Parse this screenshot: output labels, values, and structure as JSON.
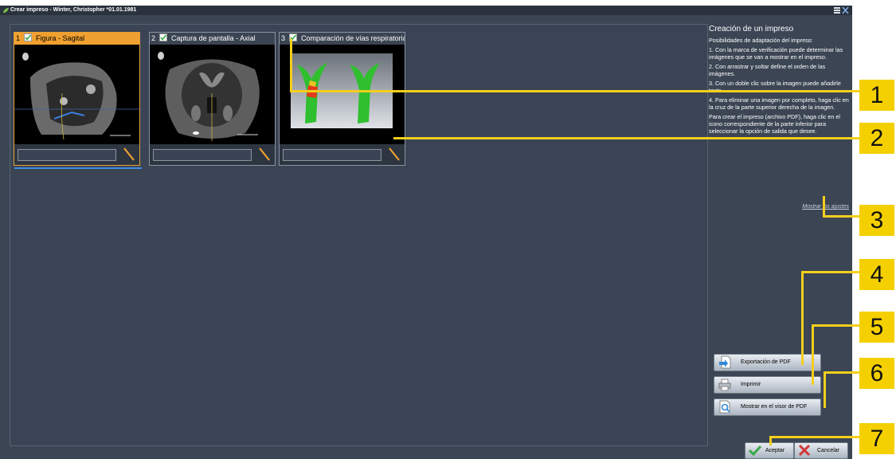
{
  "window": {
    "title": "Crear impreso - Winter, Christopher *01.01.1981"
  },
  "thumbnails": [
    {
      "number": "1",
      "label": "Figura - Sagital"
    },
    {
      "number": "2",
      "label": "Captura de pantalla - Axial"
    },
    {
      "number": "3",
      "label": "Comparación de vías respiratorias"
    }
  ],
  "panel": {
    "title": "Creación de un impreso",
    "subtitle": "Posibilidades de adaptación del impreso:",
    "step1": "1. Con la marca de verificación puede determinar las imágenes que se van a mostrar en el impreso.",
    "step2": "2. Con arrastrar y soltar define el orden de las imágenes.",
    "step3": "3. Con un doble clic sobre la imagen puede añadirle texto.",
    "step4": "4. Para eliminar una imagen por completo, haga clic en la cruz de la parte superior derecha de la imagen.",
    "step5": "Para crear el impreso (archivo PDF), haga clic en el icono correspondiente de la parte inferior para seleccionar la opción de salida que desee.",
    "settings_link": "Mostrar los ajustes"
  },
  "buttons": {
    "pdf_export": "Exportación de PDF",
    "print": "Imprimir",
    "pdf_viewer": "Mostrar en el visor de PDF",
    "accept": "Aceptar",
    "cancel": "Cancelar"
  },
  "callouts": [
    "1",
    "2",
    "3",
    "4",
    "5",
    "6",
    "7"
  ],
  "colors": {
    "callout": "#f4d000",
    "selected_thumbnail": "#f0a030",
    "selection_underline": "#3d8fe0"
  }
}
